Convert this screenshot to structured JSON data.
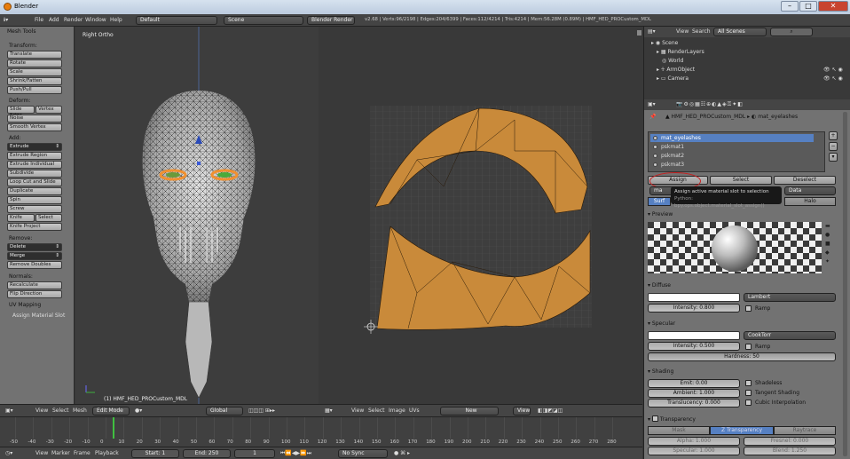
{
  "window": {
    "title": "Blender"
  },
  "info_header": {
    "menus": [
      "File",
      "Add",
      "Render",
      "Window",
      "Help"
    ],
    "layout": "Default",
    "scene": "Scene",
    "engine": "Blender Render",
    "stats": "v2.68 | Verts:96/2198 | Edges:204/6399 | Faces:112/4214 | Tris:4214 | Mem:56.28M (0.89M) | HMF_HED_PROCustom_MDL"
  },
  "tool_shelf": {
    "title": "Mesh Tools",
    "transform_label": "Transform:",
    "transform": [
      "Translate",
      "Rotate",
      "Scale",
      "Shrink/Fatten",
      "Push/Pull"
    ],
    "deform_label": "Deform:",
    "slide_edge": "Slide Edge",
    "vertex": "Vertex",
    "noise": "Noise",
    "smooth_vertex": "Smooth Vertex",
    "add_label": "Add:",
    "extrude": "Extrude",
    "add_items": [
      "Extrude Region",
      "Extrude Individual",
      "Subdivide",
      "Loop Cut and Slide",
      "Duplicate",
      "Spin",
      "Screw"
    ],
    "knife": "Knife",
    "select": "Select",
    "knife_project": "Knife Project",
    "remove_label": "Remove:",
    "delete": "Delete",
    "merge": "Merge",
    "remove_doubles": "Remove Doubles",
    "normals_label": "Normals:",
    "recalculate": "Recalculate",
    "flip_direction": "Flip Direction",
    "uv_mapping": "UV Mapping",
    "assign_material_slot": "Assign Material Slot"
  },
  "viewport": {
    "view_label": "Right Ortho",
    "object_label": "(1) HMF_HED_PROCustom_MDL"
  },
  "header_3d": {
    "menus": [
      "View",
      "Select",
      "Mesh"
    ],
    "mode": "Edit Mode",
    "orientation": "Global"
  },
  "header_uv": {
    "menus": [
      "View",
      "Select",
      "Image",
      "UVs"
    ],
    "new": "New",
    "view": "View"
  },
  "timeline": {
    "ticks": [
      "-50",
      "-40",
      "-30",
      "-20",
      "-10",
      "0",
      "10",
      "20",
      "30",
      "40",
      "50",
      "60",
      "70",
      "80",
      "90",
      "100",
      "110",
      "120",
      "130",
      "140",
      "150",
      "160",
      "170",
      "180",
      "190",
      "200",
      "210",
      "220",
      "230",
      "240",
      "250",
      "260",
      "270",
      "280"
    ],
    "menus": [
      "View",
      "Marker",
      "Frame",
      "Playback"
    ],
    "start": "Start: 1",
    "end": "End: 250",
    "current": "1",
    "sync": "No Sync"
  },
  "outliner": {
    "view": "View",
    "search": "Search",
    "scenes": "All Scenes",
    "items": [
      "Scene",
      "RenderLayers",
      "World",
      "ArmObject",
      "Camera"
    ]
  },
  "properties": {
    "breadcrumb_object": "HMF_HED_PROCustom_MDL",
    "breadcrumb_material": "mat_eyelashes",
    "slots": [
      "mat_eyelashes",
      "pskmat1",
      "pskmat2",
      "pskmat3"
    ],
    "assign": "Assign",
    "select": "Select",
    "deselect": "Deselect",
    "material_field": "ma",
    "data": "Data",
    "tooltip": "Assign active material slot to selection",
    "tooltip_python": "Python: bpy.ops.object.material_slot_assign()",
    "surface_tab": "Surf",
    "halo_tab": "Halo",
    "preview": "Preview",
    "diffuse": "Diffuse",
    "diffuse_shader": "Lambert",
    "intensity_diffuse": "Intensity: 0.800",
    "ramp": "Ramp",
    "specular": "Specular",
    "specular_shader": "CookTorr",
    "intensity_specular": "Intensity: 0.500",
    "hardness": "Hardness: 50",
    "shading": "Shading",
    "emit": "Emit: 0.00",
    "ambient": "Ambient: 1.000",
    "translucency": "Translucency: 0.000",
    "shadeless": "Shadeless",
    "tangent_shading": "Tangent Shading",
    "cubic_interpolation": "Cubic Interpolation",
    "transparency": "Transparency",
    "mask": "Mask",
    "z_transparency": "Z Transparency",
    "raytrace": "Raytrace",
    "alpha": "Alpha: 1.000",
    "fresnel": "Fresnel: 0.000",
    "specular_val": "Specular: 1.000",
    "blend": "Blend: 1.250"
  },
  "colors": {
    "accent": "#e09030",
    "selected": "#5680c2",
    "uv_face": "#c98a3a"
  }
}
